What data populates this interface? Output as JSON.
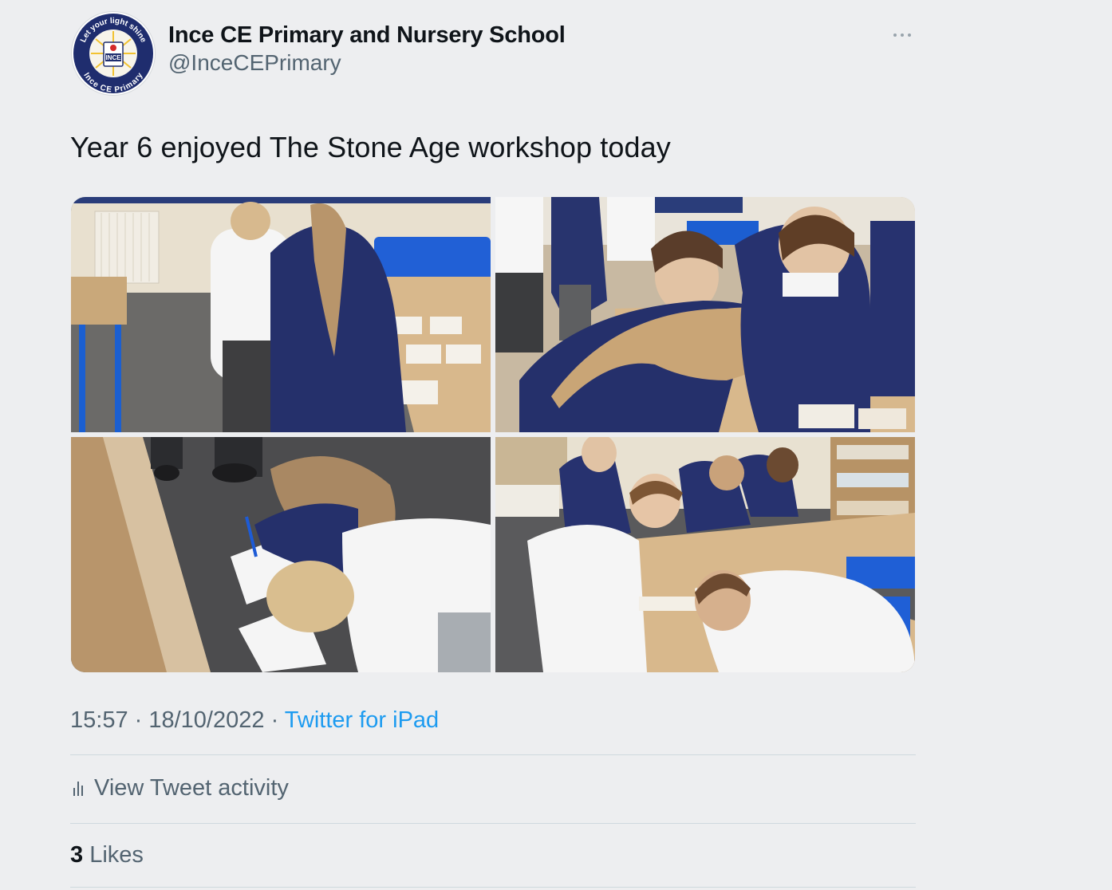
{
  "author": {
    "name": "Ince CE Primary and Nursery School",
    "handle": "@InceCEPrimary",
    "avatar": {
      "ring_top_text": "Let your light shine",
      "ring_bottom_text": "Ince CE Primary",
      "center_text": "INCE"
    }
  },
  "more_icon": "more-horizontal-icon",
  "tweet": {
    "text": "Year 6 enjoyed The Stone Age workshop today"
  },
  "media": {
    "count": 4
  },
  "meta": {
    "time": "15:57",
    "separator": " · ",
    "date": "18/10/2022",
    "source": "Twitter for iPad"
  },
  "activity": {
    "icon": "analytics-icon",
    "label": "View Tweet activity"
  },
  "likes": {
    "count": "3",
    "label": "Likes"
  },
  "colors": {
    "background": "#edeef0",
    "text": "#0f1419",
    "secondary": "#536471",
    "link": "#1d9bf0",
    "divider": "#cfd9de"
  }
}
